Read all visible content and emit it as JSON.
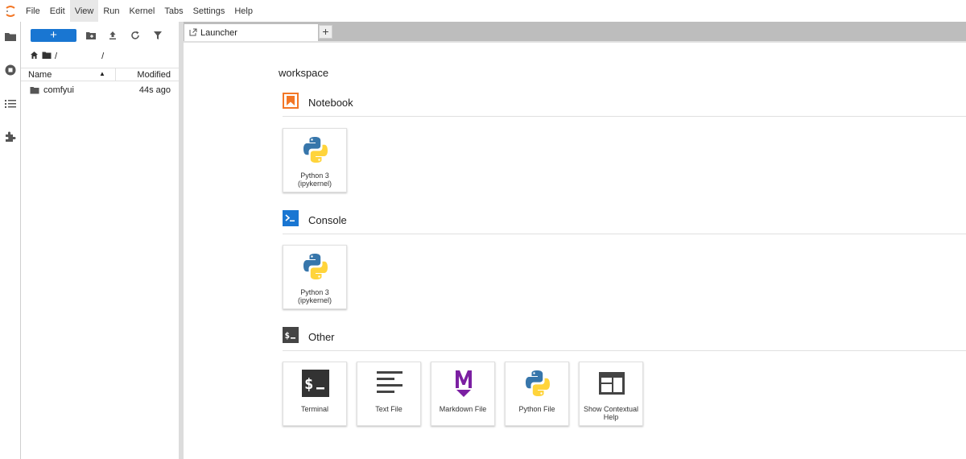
{
  "menubar": {
    "items": [
      "File",
      "Edit",
      "View",
      "Run",
      "Kernel",
      "Tabs",
      "Settings",
      "Help"
    ],
    "active": "View"
  },
  "leftbar": {
    "icons": [
      "folder-icon",
      "running-icon",
      "toc-icon",
      "extension-icon"
    ]
  },
  "filebrowser": {
    "new_label": "+",
    "breadcrumb": [
      "/",
      "/"
    ],
    "columns": {
      "name": "Name",
      "modified": "Modified"
    },
    "rows": [
      {
        "name": "comfyui",
        "modified": "44s ago"
      }
    ]
  },
  "tabs": {
    "active_label": "Launcher",
    "add_label": "+"
  },
  "launcher": {
    "cwd": "workspace",
    "sections": {
      "notebook": {
        "title": "Notebook",
        "cards": [
          {
            "label": "Python 3 (ipykernel)"
          }
        ]
      },
      "console": {
        "title": "Console",
        "cards": [
          {
            "label": "Python 3 (ipykernel)"
          }
        ]
      },
      "other": {
        "title": "Other",
        "cards": [
          {
            "label": "Terminal"
          },
          {
            "label": "Text File"
          },
          {
            "label": "Markdown File"
          },
          {
            "label": "Python File"
          },
          {
            "label": "Show Contextual Help"
          }
        ]
      }
    },
    "colors": {
      "notebook": "#f37726",
      "console": "#1976d2",
      "other": "#444444",
      "markdown": "#7b1fa2"
    }
  }
}
